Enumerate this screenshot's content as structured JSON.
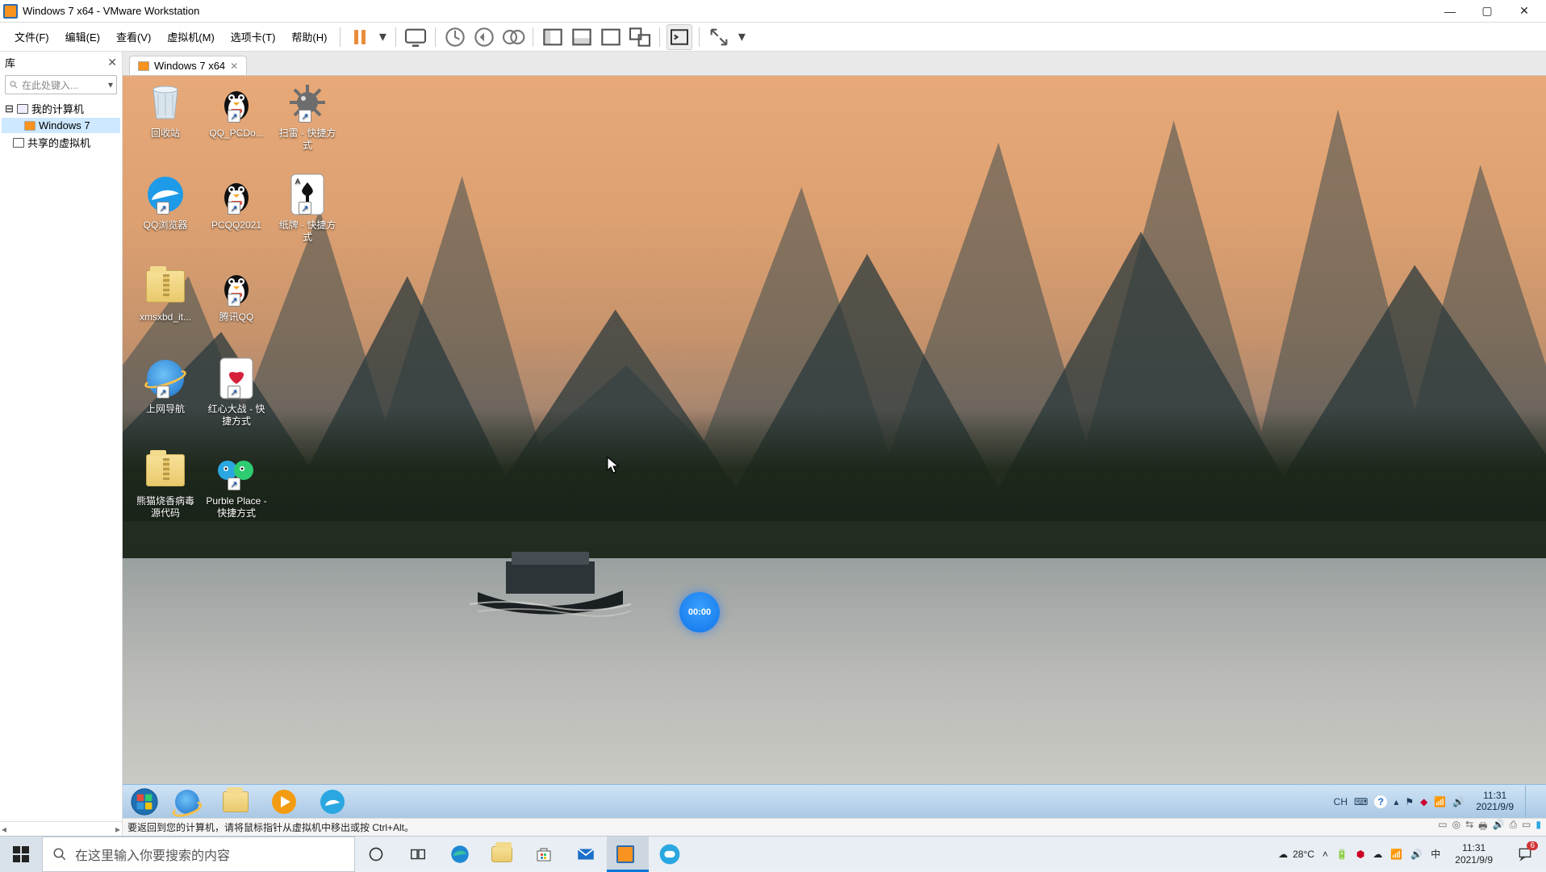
{
  "vmware": {
    "title": "Windows 7 x64 - VMware Workstation",
    "menu": {
      "file": "文件(F)",
      "edit": "编辑(E)",
      "view": "查看(V)",
      "vm": "虚拟机(M)",
      "tabs": "选项卡(T)",
      "help": "帮助(H)"
    },
    "sidebar": {
      "title": "库",
      "search_placeholder": "在此处键入...",
      "tree": {
        "root": "我的计算机",
        "vm": "Windows 7",
        "shared": "共享的虚拟机"
      }
    },
    "tab": {
      "label": "Windows 7 x64"
    },
    "statusbar": {
      "hint": "要返回到您的计算机，请将鼠标指针从虚拟机中移出或按 Ctrl+Alt。"
    }
  },
  "guest": {
    "icons": [
      {
        "id": "recycle-bin",
        "label": "回收站",
        "col": 0,
        "row": 0,
        "kind": "bin"
      },
      {
        "id": "qq-pcdo",
        "label": "QQ_PCDo...",
        "col": 1,
        "row": 0,
        "kind": "penguin-shield"
      },
      {
        "id": "minesweeper",
        "label": "扫雷 - 快捷方式",
        "col": 2,
        "row": 0,
        "kind": "mine"
      },
      {
        "id": "qq-browser",
        "label": "QQ浏览器",
        "col": 0,
        "row": 1,
        "kind": "qqbrowser"
      },
      {
        "id": "pcqq2021",
        "label": "PCQQ2021",
        "col": 1,
        "row": 1,
        "kind": "penguin-shield-box"
      },
      {
        "id": "solitaire",
        "label": "纸牌 - 快捷方式",
        "col": 2,
        "row": 1,
        "kind": "card-spade"
      },
      {
        "id": "xmsxbd",
        "label": "xmsxbd_it...",
        "col": 0,
        "row": 2,
        "kind": "folder-zip"
      },
      {
        "id": "tencent-qq",
        "label": "腾讯QQ",
        "col": 1,
        "row": 2,
        "kind": "penguin"
      },
      {
        "id": "ie-nav",
        "label": "上网导航",
        "col": 0,
        "row": 3,
        "kind": "ie"
      },
      {
        "id": "hearts",
        "label": "红心大战 - 快捷方式",
        "col": 1,
        "row": 3,
        "kind": "card-heart"
      },
      {
        "id": "panda-src",
        "label": "熊猫烧香病毒源代码",
        "col": 0,
        "row": 4,
        "kind": "folder-zip"
      },
      {
        "id": "purble",
        "label": "Purble Place - 快捷方式",
        "col": 1,
        "row": 4,
        "kind": "purble"
      }
    ],
    "timer": "00:00",
    "taskbar": {
      "tray": {
        "lang": "CH",
        "time": "11:31",
        "date": "2021/9/9"
      }
    }
  },
  "host": {
    "search_placeholder": "在这里输入你要搜索的内容",
    "weather": "28°C",
    "ime": "中",
    "clock": {
      "time": "11:31",
      "date": "2021/9/9"
    },
    "notif_count": "6"
  }
}
